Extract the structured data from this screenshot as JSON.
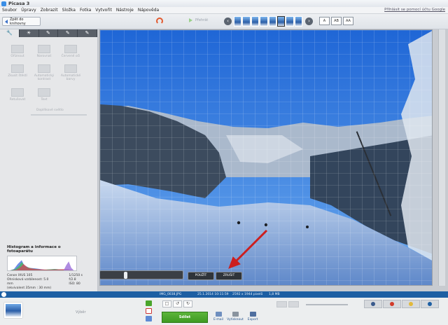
{
  "window": {
    "title": "Picasa 3"
  },
  "menu": {
    "items": [
      "Soubor",
      "Úpravy",
      "Zobrazit",
      "Složka",
      "Fotka",
      "Vytvořit",
      "Nástroje",
      "Nápověda"
    ],
    "sign_in": "Přihlásit se pomocí účtu Google"
  },
  "toolbar": {
    "back_label": "Zpět do knihovny",
    "play_label": "Přehrát",
    "view_buttons": [
      "A",
      "AB",
      "AA"
    ],
    "filmstrip_count": 8,
    "filmstrip_active": 5
  },
  "sidebar": {
    "tabs": [
      "wrench-icon",
      "sun-icon",
      "brush-icon",
      "brush-icon",
      "brush-icon"
    ],
    "tools": [
      {
        "label": "Oříznout"
      },
      {
        "label": "Narovnat"
      },
      {
        "label": "Červené oči"
      },
      {
        "label": "Zkusit štěstí"
      },
      {
        "label": "Automatický kontrast"
      },
      {
        "label": "Automatické barvy"
      },
      {
        "label": "Retušovat"
      },
      {
        "label": "Text"
      }
    ],
    "fill_light_label": "Doplňkové světlo",
    "histogram": {
      "title": "Histogram a informace o fotoaparátu",
      "exif_left": [
        "Canon IXUS 105",
        "Ohnisková vzdálenost: 5.0",
        "mm",
        "(ekvivalent 35mm : 30 mm)"
      ],
      "exif_right": [
        "1/1250 s",
        "f/2.8",
        "ISO: 80"
      ]
    }
  },
  "straighten": {
    "position": 0.3,
    "apply_label": "POUŽÍT",
    "cancel_label": "ZRUŠIT"
  },
  "status": {
    "filename": "IMG_0038.JPG",
    "date": "25.1.2014 10:11:59",
    "dimensions": "2592 x 1944 pixelů",
    "size": "1,8 MB"
  },
  "tray": {
    "label": "Výběr",
    "share_label": "Sdílet",
    "actions": [
      "E-mail",
      "Vytisknout",
      "Export"
    ]
  },
  "colors": {
    "accent": "#1d5fa3",
    "share_green": "#4aa52b",
    "annotation_arrow": "#cc1f1f"
  }
}
